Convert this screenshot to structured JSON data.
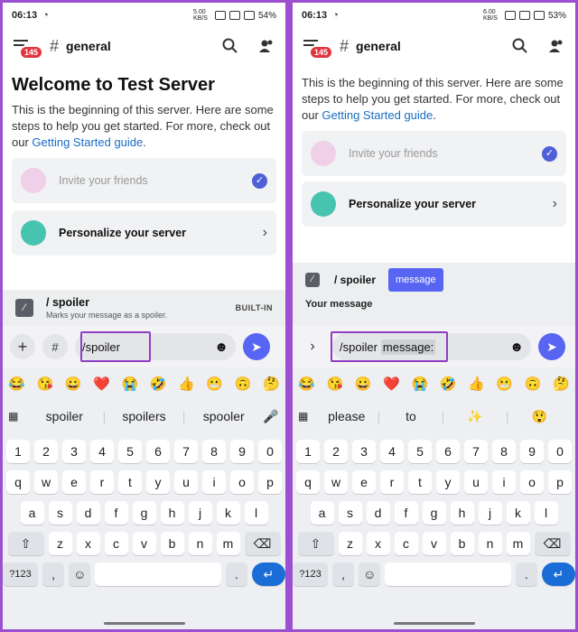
{
  "left": {
    "status": {
      "time": "06:13",
      "battery": "54%",
      "speed": "5.00 KB/S"
    },
    "header": {
      "badge": "145",
      "hash": "#",
      "channel": "general"
    },
    "welcome_title": "Welcome to Test Server",
    "desc_text": "This is the beginning of this server. Here are some steps to help you get started. For more, check out our ",
    "desc_link": "Getting Started guide",
    "desc_end": ".",
    "card1": "Invite your friends",
    "card2": "Personalize your server",
    "command": {
      "name": "/ spoiler",
      "desc": "Marks your message as a spoiler.",
      "tag": "BUILT-IN"
    },
    "input_value": "/spoiler",
    "emojis": [
      "😂",
      "😘",
      "😀",
      "❤️",
      "😭",
      "🤣",
      "👍",
      "😬",
      "🙃",
      "🤔"
    ],
    "suggestions": [
      "spoiler",
      "spoilers",
      "spooler"
    ],
    "keys": {
      "row1": [
        "1",
        "2",
        "3",
        "4",
        "5",
        "6",
        "7",
        "8",
        "9",
        "0"
      ],
      "row2": [
        "q",
        "w",
        "e",
        "r",
        "t",
        "y",
        "u",
        "i",
        "o",
        "p"
      ],
      "row3": [
        "a",
        "s",
        "d",
        "f",
        "g",
        "h",
        "j",
        "k",
        "l"
      ],
      "row4": [
        "z",
        "x",
        "c",
        "v",
        "b",
        "n",
        "m"
      ],
      "sym": "?123",
      "comma": ",",
      "period": "."
    }
  },
  "right": {
    "status": {
      "time": "06:13",
      "battery": "53%",
      "speed": "6.00 KB/S"
    },
    "header": {
      "badge": "145",
      "hash": "#",
      "channel": "general"
    },
    "desc_text": "This is the beginning of this server. Here are some steps to help you get started. For more, check out our ",
    "desc_link": "Getting Started guide",
    "desc_end": ".",
    "card1": "Invite your friends",
    "card2": "Personalize your server",
    "command": {
      "name": "/ spoiler",
      "chip": "message"
    },
    "your_message": "Your message",
    "input_value": "/spoiler",
    "input_param": "message:",
    "emojis": [
      "😂",
      "😘",
      "😀",
      "❤️",
      "😭",
      "🤣",
      "👍",
      "😬",
      "🙃",
      "🤔"
    ],
    "suggestions": [
      "please",
      "to",
      "✨",
      "😲"
    ],
    "keys": {
      "row1": [
        "1",
        "2",
        "3",
        "4",
        "5",
        "6",
        "7",
        "8",
        "9",
        "0"
      ],
      "row2": [
        "q",
        "w",
        "e",
        "r",
        "t",
        "y",
        "u",
        "i",
        "o",
        "p"
      ],
      "row3": [
        "a",
        "s",
        "d",
        "f",
        "g",
        "h",
        "j",
        "k",
        "l"
      ],
      "row4": [
        "z",
        "x",
        "c",
        "v",
        "b",
        "n",
        "m"
      ],
      "sym": "?123",
      "comma": ",",
      "period": "."
    }
  },
  "colors": {
    "accent": "#5865f2",
    "link": "#1a6cc4",
    "badge": "#e2343e",
    "highlight": "#8e3ec0",
    "frame": "#9b4fd1"
  },
  "icons": [
    "menu-icon",
    "search-icon",
    "members-icon",
    "plus-icon",
    "slash-commands-icon",
    "emoji-icon",
    "send-icon",
    "chevron-right-icon",
    "check-icon",
    "mic-icon",
    "grid-icon",
    "backspace-icon",
    "shift-icon",
    "enter-icon"
  ]
}
